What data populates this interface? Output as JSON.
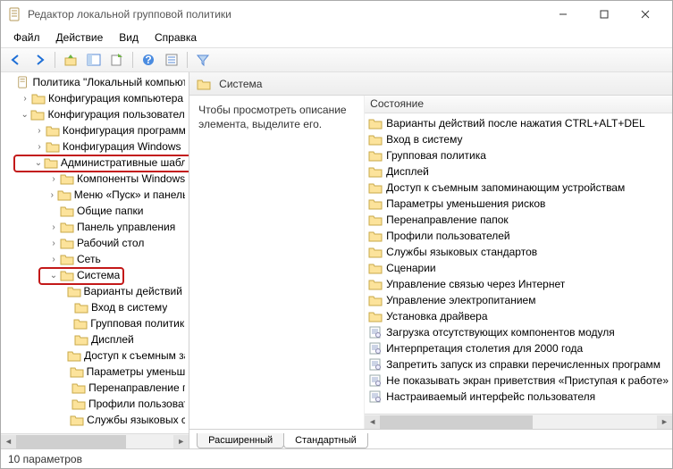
{
  "window": {
    "title": "Редактор локальной групповой политики"
  },
  "menu": {
    "file": "Файл",
    "action": "Действие",
    "view": "Вид",
    "help": "Справка"
  },
  "tree": {
    "root": "Политика \"Локальный компьютер\"",
    "computer_cfg": "Конфигурация компьютера",
    "user_cfg": "Конфигурация пользователя",
    "prog_cfg": "Конфигурация программ",
    "win_cfg": "Конфигурация Windows",
    "admin_tpl": "Административные шаблоны",
    "comp_win": "Компоненты Windows",
    "start_panel": "Меню «Пуск» и панель задач",
    "shared": "Общие папки",
    "ctrl_panel": "Панель управления",
    "desktop": "Рабочий стол",
    "network": "Сеть",
    "system": "Система",
    "sys_children": [
      "Варианты действий после нажатия CTRL+ALT+DEL",
      "Вход в систему",
      "Групповая политика",
      "Дисплей",
      "Доступ к съемным запоминающим устройствам",
      "Параметры уменьшения рисков",
      "Перенаправление папок",
      "Профили пользователей",
      "Службы языковых стандартов"
    ]
  },
  "right": {
    "header": "Система",
    "desc": "Чтобы просмотреть описание элемента, выделите его.",
    "col": "Состояние",
    "items": [
      {
        "t": "f",
        "l": "Варианты действий после нажатия CTRL+ALT+DEL"
      },
      {
        "t": "f",
        "l": "Вход в систему"
      },
      {
        "t": "f",
        "l": "Групповая политика"
      },
      {
        "t": "f",
        "l": "Дисплей"
      },
      {
        "t": "f",
        "l": "Доступ к съемным запоминающим устройствам"
      },
      {
        "t": "f",
        "l": "Параметры уменьшения рисков"
      },
      {
        "t": "f",
        "l": "Перенаправление папок"
      },
      {
        "t": "f",
        "l": "Профили пользователей"
      },
      {
        "t": "f",
        "l": "Службы языковых стандартов"
      },
      {
        "t": "f",
        "l": "Сценарии"
      },
      {
        "t": "f",
        "l": "Управление связью через Интернет"
      },
      {
        "t": "f",
        "l": "Управление электропитанием"
      },
      {
        "t": "f",
        "l": "Установка драйвера"
      },
      {
        "t": "d",
        "l": "Загрузка отсутствующих компонентов модуля"
      },
      {
        "t": "d",
        "l": "Интерпретация столетия для 2000 года"
      },
      {
        "t": "d",
        "l": "Запретить запуск из справки перечисленных программ"
      },
      {
        "t": "d",
        "l": "Не показывать экран приветствия «Приступая к работе»"
      },
      {
        "t": "d",
        "l": "Настраиваемый интерфейс пользователя"
      }
    ]
  },
  "tabs": {
    "ext": "Расширенный",
    "std": "Стандартный"
  },
  "status": "10 параметров"
}
